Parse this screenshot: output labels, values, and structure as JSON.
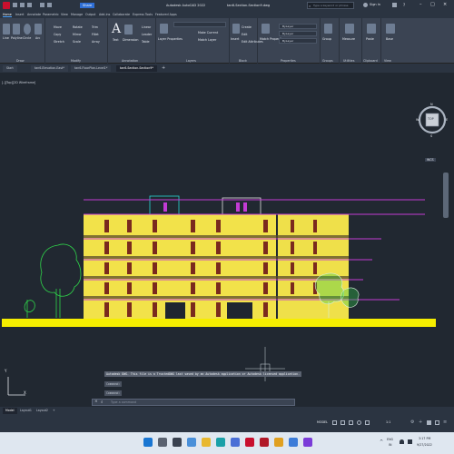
{
  "titlebar": {
    "app_title": "Autodesk AutoCAD 2022",
    "file_name": "tan6-Section-Section9.dwg",
    "search_placeholder": "Type a keyword or phrase",
    "signin_label": "Sign In",
    "share_label": "Share"
  },
  "ribbon_tabs": [
    "Home",
    "Insert",
    "Annotate",
    "Parametric",
    "View",
    "Manage",
    "Output",
    "Add-ins",
    "Collaborate",
    "Express Tools",
    "Featured Apps"
  ],
  "ribbon_groups": {
    "draw": "Draw",
    "modify": "Modify",
    "annotation": "Annotation",
    "layers": "Layers",
    "block": "Block",
    "properties": "Properties",
    "groups": "Groups",
    "utilities": "Utilities",
    "clipboard": "Clipboard",
    "view": "View"
  },
  "ribbon_tools": {
    "line": "Line",
    "polyline": "Polyline",
    "circle": "Circle",
    "arc": "Arc",
    "move": "Move",
    "rotate": "Rotate",
    "trim": "Trim",
    "copy": "Copy",
    "mirror": "Mirror",
    "fillet": "Fillet",
    "stretch": "Stretch",
    "scale": "Scale",
    "array": "Array",
    "text": "Text",
    "dimension": "Dimension",
    "linear": "Linear",
    "leader": "Leader",
    "table": "Table",
    "layer_properties": "Layer Properties",
    "make_current": "Make Current",
    "match_layer": "Match Layer",
    "insert": "Insert",
    "create": "Create",
    "edit": "Edit",
    "edit_attributes": "Edit Attributes",
    "match_properties": "Match Properties",
    "bylayer": "ByLayer",
    "group": "Group",
    "measure": "Measure",
    "paste": "Paste",
    "base": "Base"
  },
  "doc_tabs": [
    "Start",
    "tan6-Elevation-East*",
    "tan6-FloorPlan-Level1*",
    "tan6-Section-Section9*"
  ],
  "viewport_label": "[-][Top][2D Wireframe]",
  "viewcube": {
    "top": "TOP",
    "north": "N",
    "south": "S",
    "east": "E",
    "west": "W",
    "wcs": "WCS"
  },
  "ucs": {
    "x": "X",
    "y": "Y"
  },
  "command_history": [
    "Autodesk DWG. This file is a TrustedDWG last saved by an Autodesk application or Autodesk licensed application.",
    "Command:",
    "Command:"
  ],
  "command_placeholder": "Type a command",
  "layout_tabs": [
    "Model",
    "Layout1",
    "Layout2"
  ],
  "layout_add": "+",
  "status": {
    "model": "MODEL",
    "scale": "1:1"
  },
  "clock": {
    "time": "3:17 PM",
    "date": "9/27/2022"
  },
  "tray": {
    "lang": "ENG",
    "locale": "IN"
  },
  "colors": {
    "accent": "#4aa3ff",
    "building": "#f2e24a",
    "ground": "#f6ee00",
    "magenta": "#c23bd4",
    "tree": "#2fd54a",
    "canvas": "#212831"
  }
}
